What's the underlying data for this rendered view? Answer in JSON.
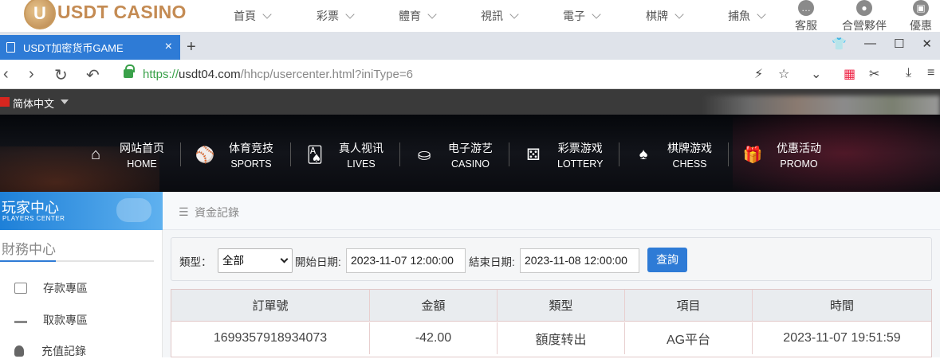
{
  "site_nav": {
    "logo_text": "USDT CASINO",
    "logo_mark": "U",
    "items": [
      {
        "label": "首頁"
      },
      {
        "label": "彩票"
      },
      {
        "label": "體育"
      },
      {
        "label": "視訊"
      },
      {
        "label": "電子"
      },
      {
        "label": "棋牌"
      },
      {
        "label": "捕魚"
      }
    ],
    "icon_items": [
      {
        "label": "客服",
        "icon": "chat-icon"
      },
      {
        "label": "合營夥伴",
        "icon": "partners-icon"
      },
      {
        "label": "優惠",
        "icon": "gift-icon"
      }
    ]
  },
  "browser": {
    "tab_title": "USDT加密货币GAME",
    "tab_close": "×",
    "new_tab": "+",
    "url_scheme": "https://",
    "url_host": "usdt04.com",
    "url_path": "/hhcp/usercenter.html?iniType=6"
  },
  "lang": {
    "current": "简体中文"
  },
  "hero_nav": [
    {
      "zh": "网站首页",
      "en": "HOME",
      "icon": "home-icon"
    },
    {
      "zh": "体育竞技",
      "en": "SPORTS",
      "icon": "ball-icon"
    },
    {
      "zh": "真人视讯",
      "en": "LIVES",
      "icon": "cards-icon"
    },
    {
      "zh": "电子游艺",
      "en": "CASINO",
      "icon": "slot-icon"
    },
    {
      "zh": "彩票游戏",
      "en": "LOTTERY",
      "icon": "dice-icon"
    },
    {
      "zh": "棋牌游戏",
      "en": "CHESS",
      "icon": "spade-icon"
    },
    {
      "zh": "优惠活动",
      "en": "PROMO",
      "icon": "gift-icon"
    }
  ],
  "sidebar": {
    "banner_title": "玩家中心",
    "banner_sub": "PLAYERS CENTER",
    "section_title": "財務中心",
    "items": [
      {
        "label": "存款專區",
        "icon": "deposit-icon"
      },
      {
        "label": "取款專區",
        "icon": "withdraw-icon"
      },
      {
        "label": "充值記錄",
        "icon": "recharge-icon"
      }
    ]
  },
  "main": {
    "breadcrumb": "資金記錄",
    "filter": {
      "type_label": "類型：",
      "type_value": "全部",
      "start_label": "開始日期:",
      "start_value": "2023-11-07 12:00:00",
      "end_label": "結束日期:",
      "end_value": "2023-11-08 12:00:00",
      "query_label": "查詢"
    },
    "table": {
      "headers": [
        "訂單號",
        "金額",
        "類型",
        "項目",
        "時間"
      ],
      "rows": [
        [
          "1699357918934073",
          "-42.00",
          "額度转出",
          "AG平台",
          "2023-11-07 19:51:59"
        ]
      ]
    }
  }
}
